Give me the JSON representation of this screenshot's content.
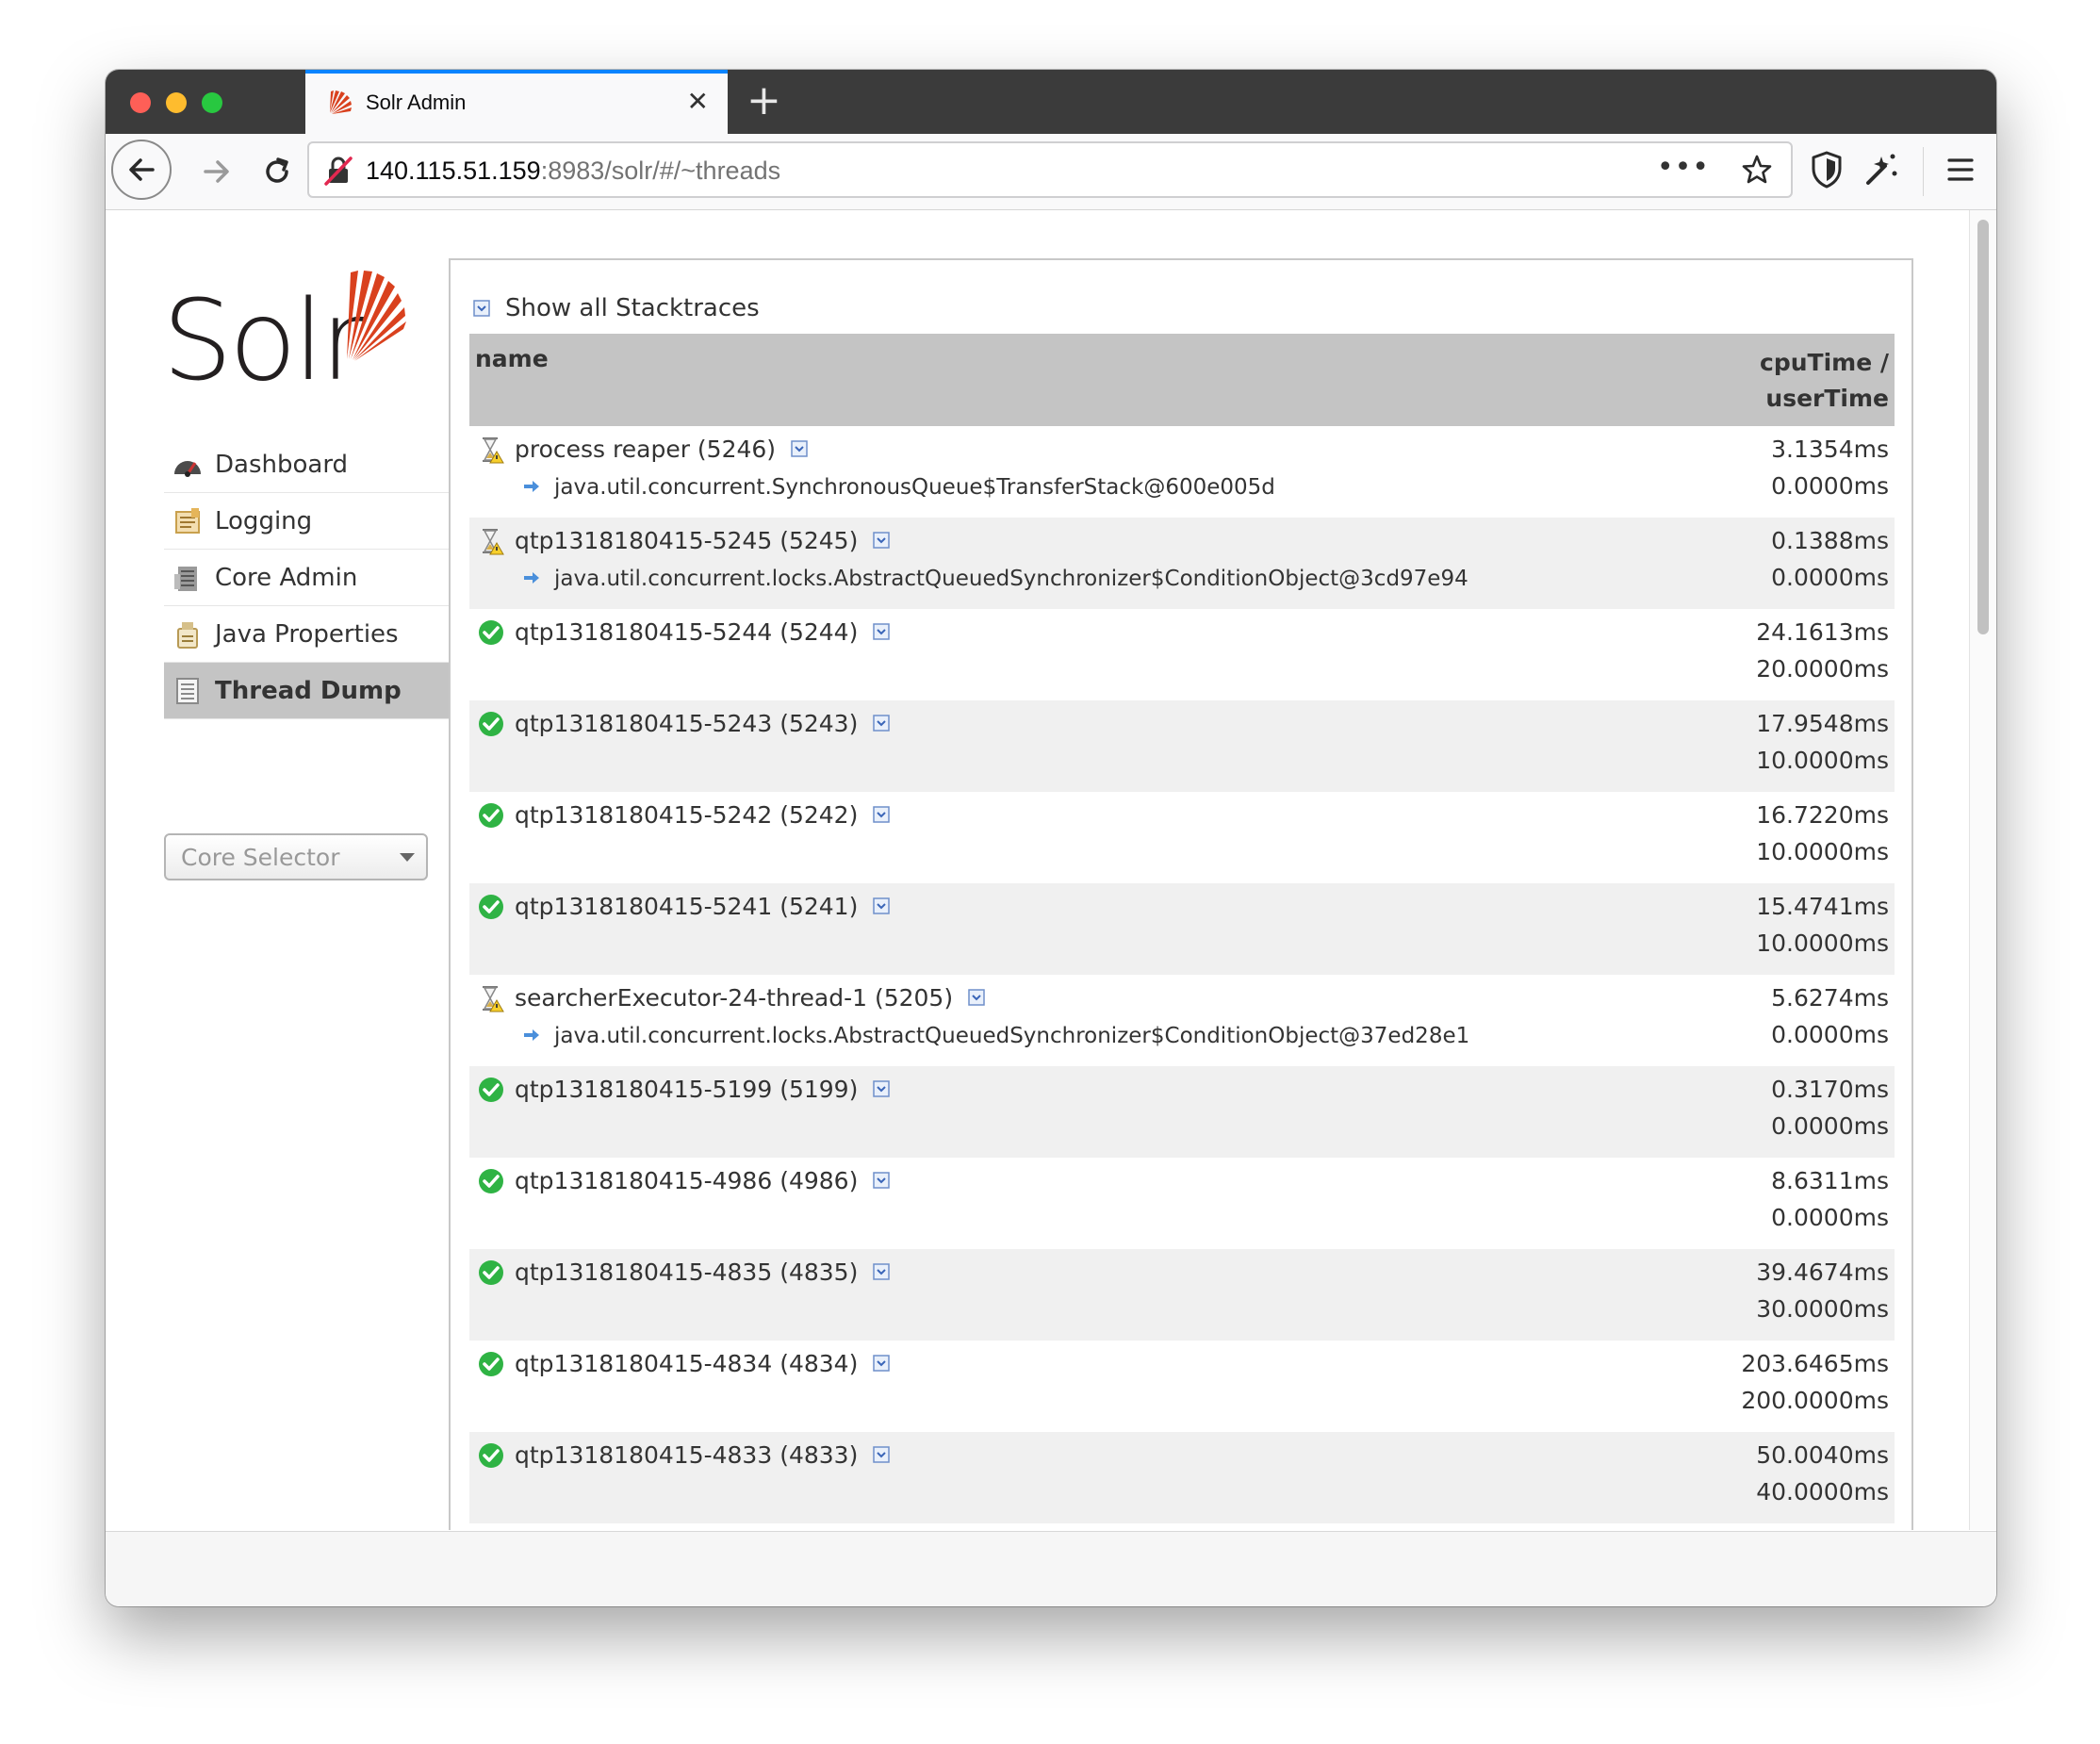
{
  "browser": {
    "tab_title": "Solr Admin",
    "tab_close": "✕",
    "new_tab": "+",
    "url_host": "140.115.51.159",
    "url_rest": ":8983/solr/#/~threads",
    "url_more": "•••",
    "accent": "#0a84ff"
  },
  "logo": {
    "text": "Solr",
    "color": "#d9411e"
  },
  "menu": {
    "items": [
      {
        "label": "Dashboard",
        "icon": "dashboard-icon"
      },
      {
        "label": "Logging",
        "icon": "logging-icon"
      },
      {
        "label": "Core Admin",
        "icon": "core-admin-icon"
      },
      {
        "label": "Java Properties",
        "icon": "java-properties-icon"
      },
      {
        "label": "Thread Dump",
        "icon": "thread-dump-icon",
        "active": true
      }
    ]
  },
  "core_selector": {
    "placeholder": "Core Selector"
  },
  "threads": {
    "show_all_label": "Show all Stacktraces",
    "columns": {
      "name": "name",
      "cpu_line1": "cpuTime /",
      "cpu_line2": "userTime"
    },
    "rows": [
      {
        "state": "waiting",
        "name": "process reaper (5246)",
        "lock": "java.util.concurrent.SynchronousQueue$TransferStack@600e005d",
        "cpu": "3.1354ms",
        "user": "0.0000ms"
      },
      {
        "state": "waiting",
        "name": "qtp1318180415-5245 (5245)",
        "lock": "java.util.concurrent.locks.AbstractQueuedSynchronizer$ConditionObject@3cd97e94",
        "cpu": "0.1388ms",
        "user": "0.0000ms"
      },
      {
        "state": "runnable",
        "name": "qtp1318180415-5244 (5244)",
        "lock": "",
        "cpu": "24.1613ms",
        "user": "20.0000ms"
      },
      {
        "state": "runnable",
        "name": "qtp1318180415-5243 (5243)",
        "lock": "",
        "cpu": "17.9548ms",
        "user": "10.0000ms"
      },
      {
        "state": "runnable",
        "name": "qtp1318180415-5242 (5242)",
        "lock": "",
        "cpu": "16.7220ms",
        "user": "10.0000ms"
      },
      {
        "state": "runnable",
        "name": "qtp1318180415-5241 (5241)",
        "lock": "",
        "cpu": "15.4741ms",
        "user": "10.0000ms"
      },
      {
        "state": "waiting",
        "name": "searcherExecutor-24-thread-1 (5205)",
        "lock": "java.util.concurrent.locks.AbstractQueuedSynchronizer$ConditionObject@37ed28e1",
        "cpu": "5.6274ms",
        "user": "0.0000ms"
      },
      {
        "state": "runnable",
        "name": "qtp1318180415-5199 (5199)",
        "lock": "",
        "cpu": "0.3170ms",
        "user": "0.0000ms"
      },
      {
        "state": "runnable",
        "name": "qtp1318180415-4986 (4986)",
        "lock": "",
        "cpu": "8.6311ms",
        "user": "0.0000ms"
      },
      {
        "state": "runnable",
        "name": "qtp1318180415-4835 (4835)",
        "lock": "",
        "cpu": "39.4674ms",
        "user": "30.0000ms"
      },
      {
        "state": "runnable",
        "name": "qtp1318180415-4834 (4834)",
        "lock": "",
        "cpu": "203.6465ms",
        "user": "200.0000ms"
      },
      {
        "state": "runnable",
        "name": "qtp1318180415-4833 (4833)",
        "lock": "",
        "cpu": "50.0040ms",
        "user": "40.0000ms"
      }
    ]
  }
}
